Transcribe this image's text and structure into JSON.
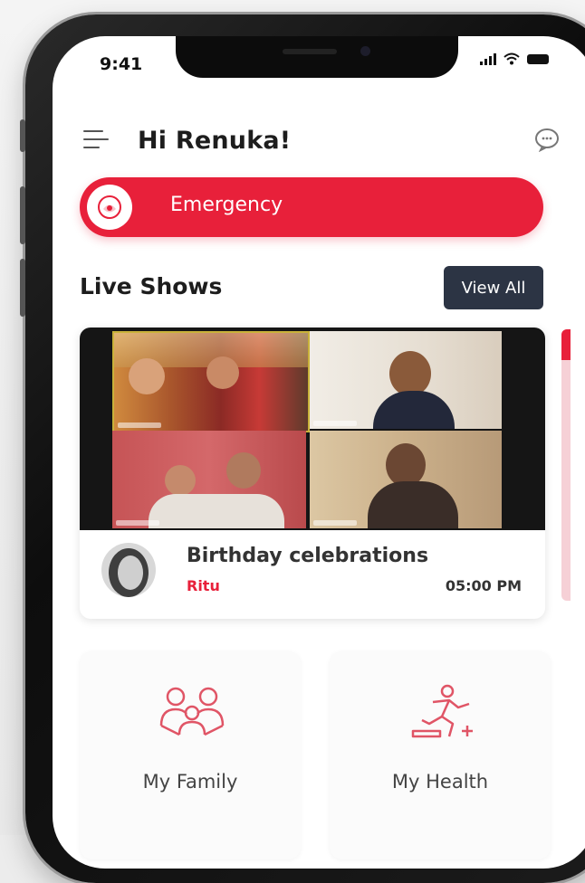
{
  "status_bar": {
    "time": "9:41"
  },
  "header": {
    "greeting": "Hi Renuka!",
    "menu_icon": "hamburger-menu-icon",
    "chat_icon": "chat-icon"
  },
  "emergency": {
    "label": "Emergency",
    "icon": "sos-icon"
  },
  "live_shows": {
    "title": "Live Shows",
    "view_all_label": "View All",
    "featured_show": {
      "title": "Birthday celebrations",
      "host": "Ritu",
      "time": "05:00 PM"
    }
  },
  "features": [
    {
      "label": "My Family",
      "icon": "family-icon"
    },
    {
      "label": "My Health",
      "icon": "exercise-icon"
    }
  ],
  "colors": {
    "accent": "#e8203a",
    "dark_button": "#2c3444",
    "text": "#1d1d1d"
  }
}
